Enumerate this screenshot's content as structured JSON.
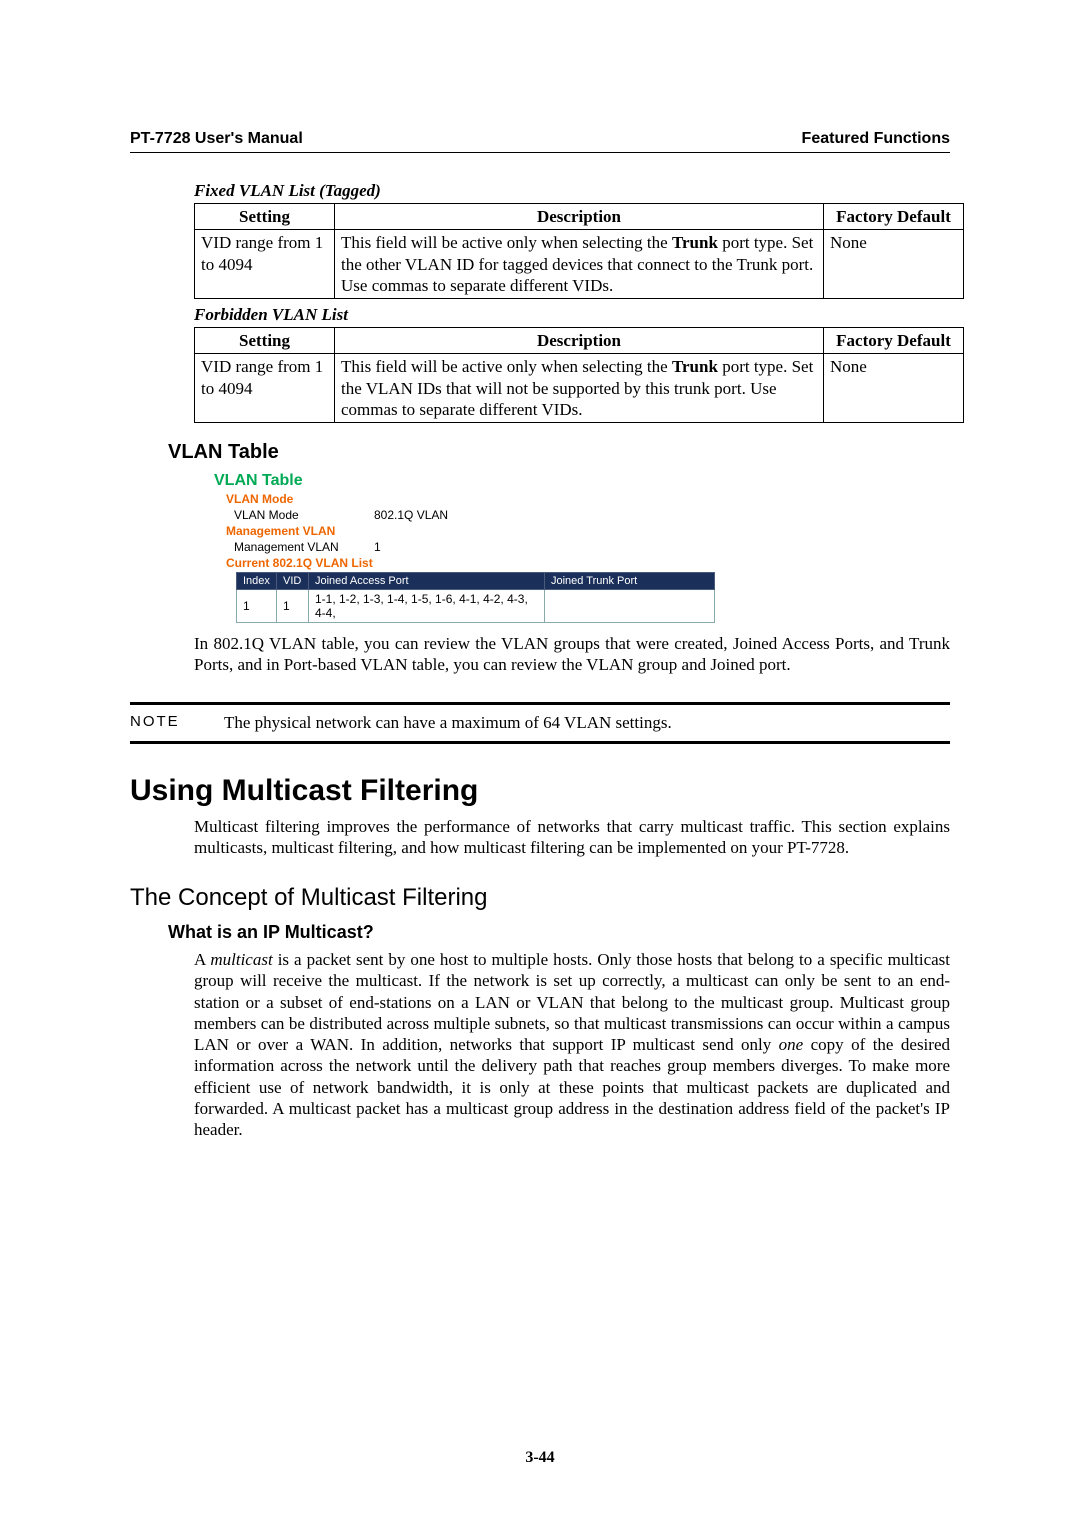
{
  "header": {
    "left": "PT-7728 User's Manual",
    "right": "Featured Functions"
  },
  "table1": {
    "caption": "Fixed VLAN List (Tagged)",
    "h1": "Setting",
    "h2": "Description",
    "h3": "Factory Default",
    "setting": "VID range from 1 to 4094",
    "desc_pre": "This field will be active only when selecting the ",
    "desc_bold": "Trunk",
    "desc_post": " port type. Set the other VLAN ID for tagged devices that connect to the Trunk port. Use commas to separate different VIDs.",
    "def": "None"
  },
  "table2": {
    "caption": "Forbidden VLAN List",
    "h1": "Setting",
    "h2": "Description",
    "h3": "Factory Default",
    "setting": "VID range from 1 to 4094",
    "desc_pre": "This field will be active only when selecting the ",
    "desc_bold": "Trunk",
    "desc_post": " port type. Set the VLAN IDs that will not be supported by this trunk port. Use commas to separate different VIDs.",
    "def": "None"
  },
  "vlan_heading": "VLAN Table",
  "vlan_shot": {
    "title": "VLAN Table",
    "sec1": "VLAN Mode",
    "row1_lab": "VLAN Mode",
    "row1_val": "802.1Q VLAN",
    "sec2": "Management VLAN",
    "row2_lab": "Management VLAN",
    "row2_val": "1",
    "sec3": "Current 802.1Q VLAN List",
    "th1": "Index",
    "th2": "VID",
    "th3": "Joined Access Port",
    "th4": "Joined Trunk Port",
    "td1": "1",
    "td2": "1",
    "td3": "1-1, 1-2, 1-3, 1-4, 1-5, 1-6, 4-1, 4-2, 4-3, 4-4,",
    "td4": ""
  },
  "vlan_para": "In 802.1Q VLAN table, you can review the VLAN groups that were created, Joined Access Ports, and Trunk Ports, and in Port-based VLAN table, you can review the VLAN group and Joined port.",
  "note": {
    "label": "NOTE",
    "text": "The physical network can have a maximum of 64 VLAN settings."
  },
  "h1": "Using Multicast Filtering",
  "para2": "Multicast filtering improves the performance of networks that carry multicast traffic. This section explains multicasts, multicast filtering, and how multicast filtering can be implemented on your PT-7728.",
  "h2": "The Concept of Multicast Filtering",
  "h3": "What is an IP Multicast?",
  "para3_pre": "A ",
  "para3_em": "multicast",
  "para3_mid": " is a packet sent by one host to multiple hosts. Only those hosts that belong to a specific multicast group will receive the multicast. If the network is set up correctly, a multicast can only be sent to an end-station or a subset of end-stations on a LAN or VLAN that belong to the multicast group. Multicast group members can be distributed across multiple subnets, so that multicast transmissions can occur within a campus LAN or over a WAN. In addition, networks that support IP multicast send only ",
  "para3_em2": "one",
  "para3_post": " copy of the desired information across the network until the delivery path that reaches group members diverges. To make more efficient use of network bandwidth, it is only at these points that multicast packets are duplicated and forwarded. A multicast packet has a multicast group address in the destination address field of the packet's IP header.",
  "pagenum": "3-44"
}
